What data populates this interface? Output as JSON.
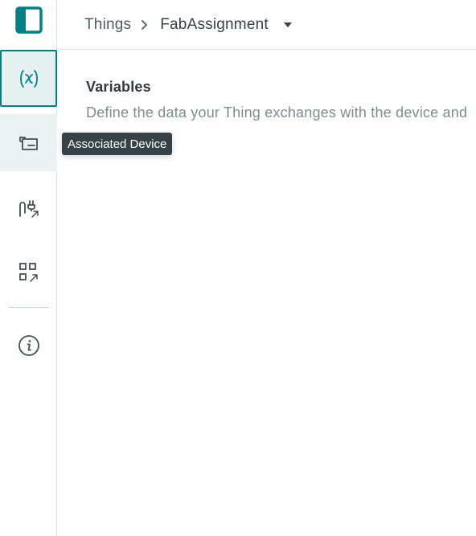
{
  "header": {
    "breadcrumb_root": "Things",
    "breadcrumb_current": "FabAssignment"
  },
  "sidebar": {
    "items": [
      {
        "id": "variables",
        "icon": "variable-icon",
        "active": true
      },
      {
        "id": "associated-device",
        "icon": "device-icon",
        "hovered": true
      },
      {
        "id": "network",
        "icon": "plug-icon"
      },
      {
        "id": "sketch",
        "icon": "qr-sketch-icon"
      },
      {
        "id": "info",
        "icon": "info-icon"
      }
    ]
  },
  "tooltip": {
    "text": "Associated Device"
  },
  "main": {
    "title": "Variables",
    "description": "Define the data your Thing exchanges with the device and"
  },
  "colors": {
    "accent": "#008184",
    "active_bg": "#e5f1f1",
    "text_dark": "#2f393d",
    "text_muted": "#7f8c8d",
    "tooltip_bg": "#374146"
  }
}
